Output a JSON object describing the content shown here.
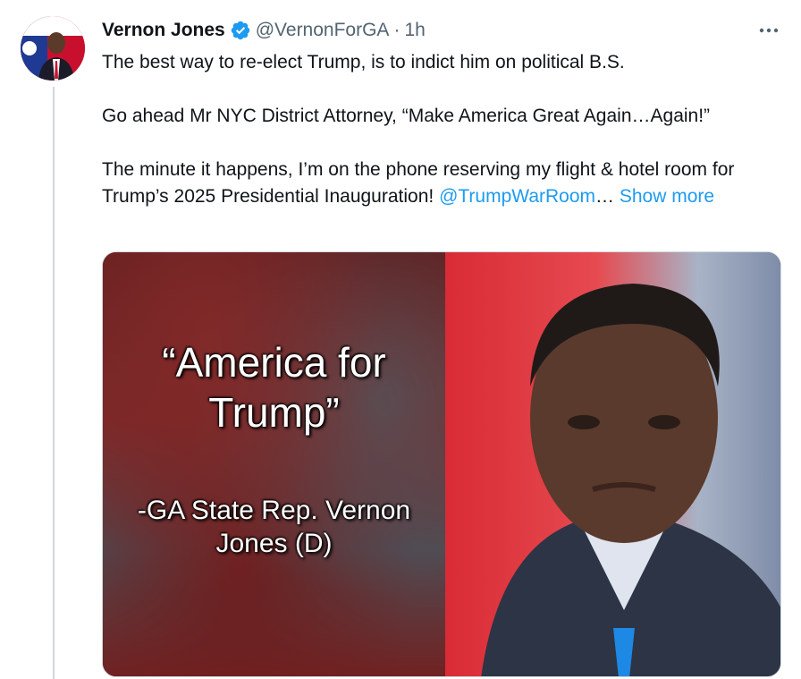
{
  "author": {
    "name": "Vernon Jones",
    "handle": "@VernonForGA",
    "time": "1h",
    "verified_color": "#1d9bf0"
  },
  "more_menu_icon": "more-horizontal-icon",
  "tweet": {
    "line1": "The best way to re-elect Trump, is to indict him on political B.S.",
    "line2": "Go ahead Mr NYC District Attorney,  “Make America Great Again…Again!”",
    "line3_before": "The minute it happens, I’m on the phone reserving my flight & hotel room for Trump’s 2025 Presidential Inauguration! ",
    "mention": "@TrumpWarRoom",
    "ellipsis": "… ",
    "show_more": "Show more"
  },
  "media": {
    "quote": "“America for Trump”",
    "attribution": "-GA State Rep. Vernon Jones (D)"
  },
  "colors": {
    "link": "#1d9bf0",
    "secondary_text": "#536471",
    "thread_line": "#cfd9de"
  }
}
